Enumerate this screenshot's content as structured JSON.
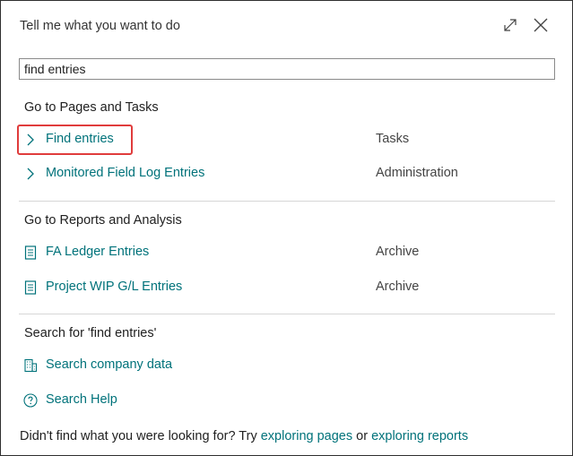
{
  "header": {
    "title": "Tell me what you want to do",
    "expand_icon": "expand-icon",
    "close_icon": "close-icon"
  },
  "search": {
    "value": "find entries"
  },
  "pages_section": {
    "title": "Go to Pages and Tasks",
    "items": [
      {
        "label": "Find entries",
        "category": "Tasks",
        "icon": "chevron-right-icon"
      },
      {
        "label": "Monitored Field Log Entries",
        "category": "Administration",
        "icon": "chevron-right-icon"
      }
    ]
  },
  "reports_section": {
    "title": "Go to Reports and Analysis",
    "items": [
      {
        "label": "FA Ledger Entries",
        "category": "Archive",
        "icon": "report-icon"
      },
      {
        "label": "Project WIP G/L Entries",
        "category": "Archive",
        "icon": "report-icon"
      }
    ]
  },
  "search_section": {
    "title": "Search for 'find entries'",
    "items": [
      {
        "label": "Search company data",
        "icon": "building-icon"
      },
      {
        "label": "Search Help",
        "icon": "help-icon"
      }
    ]
  },
  "footer": {
    "prefix": "Didn't find what you were looking for? Try ",
    "link1": "exploring pages",
    "middle": " or ",
    "link2": "exploring reports"
  },
  "colors": {
    "link": "#00727a",
    "highlight": "#e03c3c",
    "divider": "#d6d6d6"
  }
}
